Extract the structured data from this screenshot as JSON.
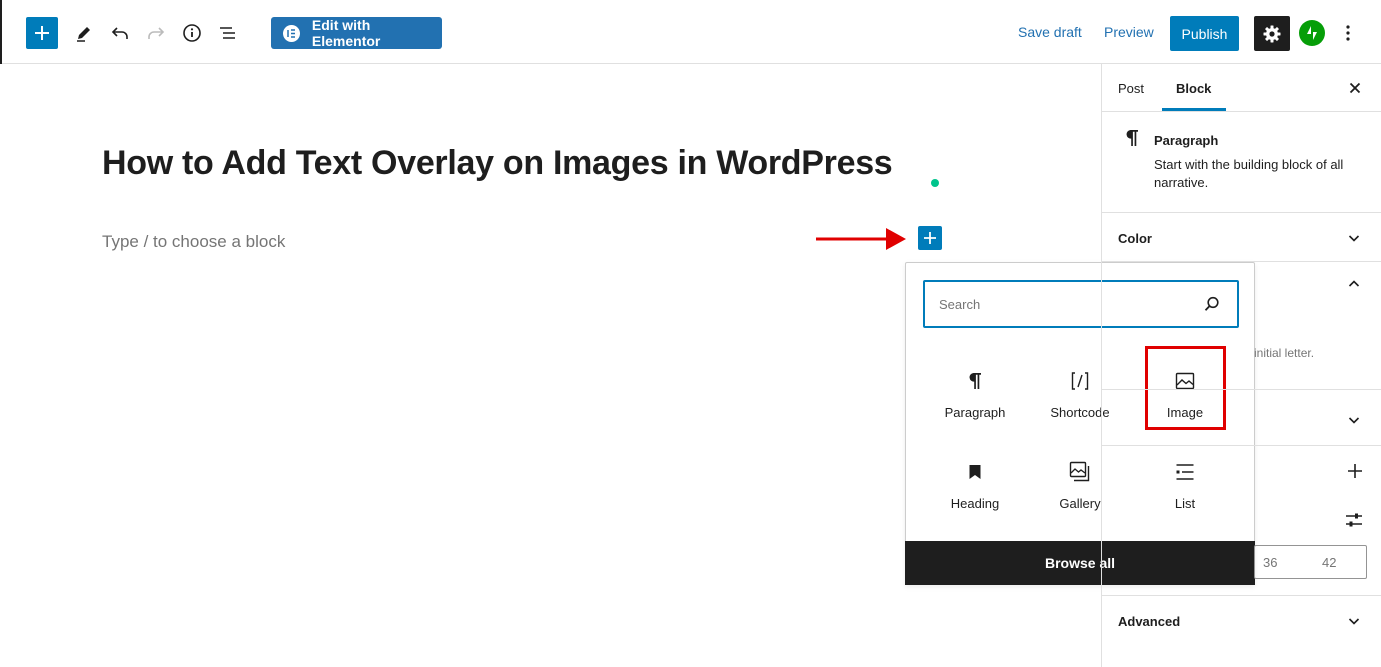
{
  "toolbar": {
    "elementor_label": "Edit with Elementor",
    "save_draft": "Save draft",
    "preview": "Preview",
    "publish": "Publish"
  },
  "editor": {
    "title": "How to Add Text Overlay on Images in WordPress",
    "placeholder": "Type / to choose a block"
  },
  "inserter": {
    "search_placeholder": "Search",
    "blocks": [
      {
        "label": "Paragraph",
        "icon": "paragraph-icon"
      },
      {
        "label": "Shortcode",
        "icon": "shortcode-icon"
      },
      {
        "label": "Image",
        "icon": "image-icon"
      },
      {
        "label": "Heading",
        "icon": "heading-icon"
      },
      {
        "label": "Gallery",
        "icon": "gallery-icon"
      },
      {
        "label": "List",
        "icon": "list-icon"
      }
    ],
    "browse_all": "Browse all"
  },
  "sidebar": {
    "tabs": [
      "Post",
      "Block"
    ],
    "active_tab": "Block",
    "block": {
      "name": "Paragraph",
      "description": "Start with the building block of all narrative."
    },
    "panels": {
      "color": "Color",
      "advanced": "Advanced"
    },
    "partial_text": "initial letter.",
    "font_sizes": [
      "36",
      "42"
    ]
  },
  "colors": {
    "accent": "#007cba",
    "elementor": "#2271b1",
    "jetpack": "#069e08",
    "highlight": "#e00000",
    "dark": "#1e1e1e"
  }
}
